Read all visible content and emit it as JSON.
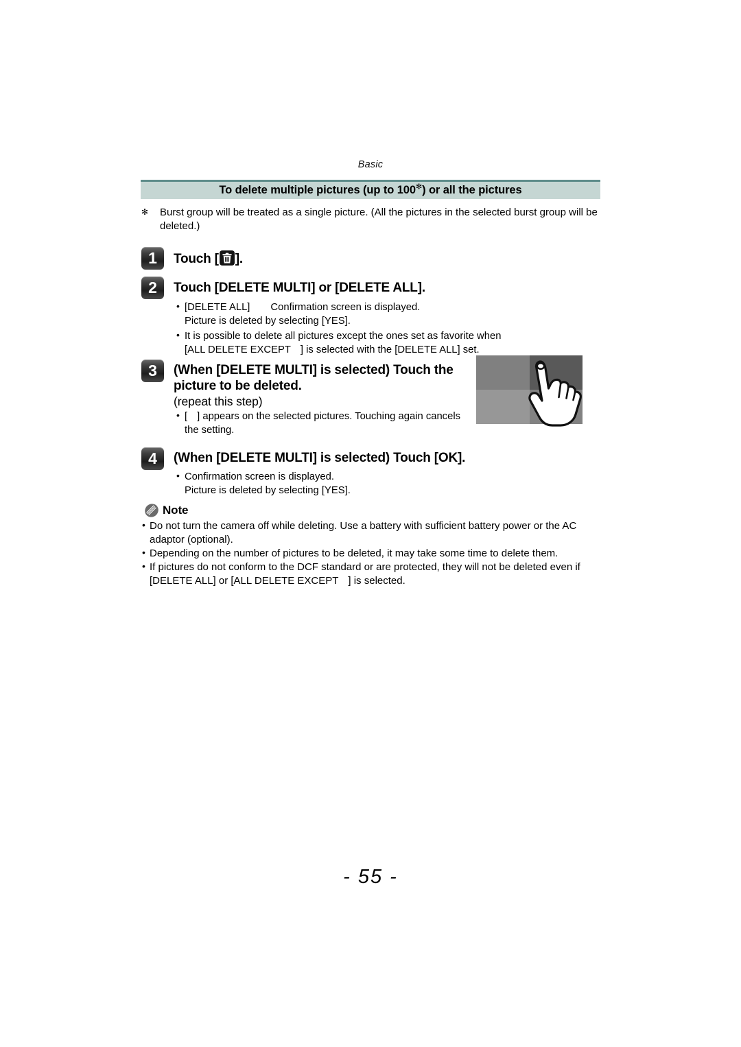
{
  "page": {
    "running_head": "Basic",
    "page_number": "- 55 -"
  },
  "banner": {
    "title_before": "To delete multiple pictures (up to 100",
    "title_marker": "✻",
    "title_after": ") or all the pictures"
  },
  "footnote": {
    "marker": "✻",
    "text": "Burst group will be treated as a single picture. (All the pictures in the selected burst group will be deleted.)"
  },
  "steps": [
    {
      "number": "1",
      "heading_before": "Touch [",
      "icon": "trash-icon",
      "heading_after": "].",
      "bullets": []
    },
    {
      "number": "2",
      "heading": "Touch [DELETE MULTI] or [DELETE ALL].",
      "bullets": [
        {
          "parts": [
            "[DELETE ALL]",
            "GAP",
            "Confirmation screen is displayed."
          ],
          "line2": "Picture is deleted by selecting [YES]."
        },
        {
          "line1": "It is possible to delete all pictures except the ones set as favorite when",
          "parts2": [
            "[ALL DELETE EXCEPT",
            "GAP",
            "] is selected with the [DELETE ALL] set."
          ]
        }
      ]
    },
    {
      "number": "3",
      "heading_line1": "(When [DELETE MULTI] is selected) Touch the",
      "heading_line2": "picture to be deleted.",
      "subheading": "(repeat this step)",
      "bullets": [
        {
          "parts": [
            "[",
            "GAP",
            "] appears on the selected pictures. Touching again cancels"
          ],
          "line2": "the setting."
        }
      ]
    },
    {
      "number": "4",
      "heading": "(When [DELETE MULTI] is selected) Touch [OK].",
      "bullets": [
        {
          "line1": "Confirmation screen is displayed.",
          "line2": "Picture is deleted by selecting [YES]."
        }
      ]
    }
  ],
  "illustration": {
    "name": "touch-picture-grid",
    "quadrant_colors": [
      "#808080",
      "#595959",
      "#979797",
      "#828282"
    ],
    "hand_position": "top-right"
  },
  "note": {
    "label": "Note",
    "items": [
      {
        "line1": "Do not turn the camera off while deleting. Use a battery with sufficient battery power or the AC",
        "line2": "adaptor (optional)."
      },
      {
        "line1": "Depending on the number of pictures to be deleted, it may take some time to delete them.",
        "line2": ""
      },
      {
        "line1": "If pictures do not conform to the DCF standard or are protected, they will not be deleted even if",
        "parts2": [
          "[DELETE ALL] or [ALL DELETE EXCEPT",
          "GAP",
          "] is selected."
        ]
      }
    ]
  },
  "colors": {
    "banner_fill": "#c5d6d3",
    "banner_rule": "#5d8c8a",
    "badge_dark": "#1d1d1d"
  }
}
